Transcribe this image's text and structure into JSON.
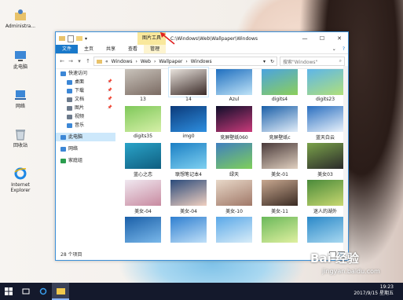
{
  "desktop": {
    "icons": [
      {
        "label": "Administra...",
        "icon": "user-folder-icon"
      },
      {
        "label": "此电脑",
        "icon": "computer-icon"
      },
      {
        "label": "网络",
        "icon": "network-icon"
      },
      {
        "label": "回收站",
        "icon": "recycle-bin-icon"
      },
      {
        "label": "Internet Explorer",
        "icon": "ie-icon"
      }
    ]
  },
  "window": {
    "picture_tools_label": "图片工具",
    "title": "C:\\Windows\\Web\\Wallpaper\\Windows",
    "ribbon_tabs": [
      "文件",
      "主页",
      "共享",
      "查看",
      "管理"
    ],
    "breadcrumb": [
      "Windows",
      "Web",
      "Wallpaper",
      "Windows"
    ],
    "search_placeholder": "搜索\"Windows\"",
    "status": "28 个项目"
  },
  "nav": [
    {
      "label": "快速访问",
      "icon": "star-icon",
      "color": "#3c87d6",
      "level": 0,
      "pinned": false
    },
    {
      "label": "桌面",
      "icon": "desktop-icon",
      "color": "#3c87d6",
      "level": 1,
      "pinned": true
    },
    {
      "label": "下载",
      "icon": "download-icon",
      "color": "#3c87d6",
      "level": 1,
      "pinned": true
    },
    {
      "label": "文档",
      "icon": "document-icon",
      "color": "#6c7a8c",
      "level": 1,
      "pinned": true
    },
    {
      "label": "图片",
      "icon": "pictures-icon",
      "color": "#6c7a8c",
      "level": 1,
      "pinned": true
    },
    {
      "label": "视频",
      "icon": "video-icon",
      "color": "#6c7a8c",
      "level": 1,
      "pinned": false
    },
    {
      "label": "音乐",
      "icon": "music-icon",
      "color": "#3c87d6",
      "level": 1,
      "pinned": false
    },
    {
      "label": "此电脑",
      "icon": "computer-icon",
      "color": "#3c87d6",
      "level": 0,
      "pinned": false,
      "selected": true
    },
    {
      "label": "网络",
      "icon": "network-icon",
      "color": "#3c87d6",
      "level": 0,
      "pinned": false
    },
    {
      "label": "家庭组",
      "icon": "homegroup-icon",
      "color": "#2b9d4f",
      "level": 0,
      "pinned": false
    }
  ],
  "files": [
    {
      "name": "13",
      "colors": [
        "#c9c3bb",
        "#7a6a62"
      ]
    },
    {
      "name": "14",
      "colors": [
        "#e8e2dc",
        "#3b2b28"
      ],
      "selected": true
    },
    {
      "name": "Azul",
      "colors": [
        "#1f6fbf",
        "#bfe3f7"
      ]
    },
    {
      "name": "digits4",
      "colors": [
        "#4aa3e0",
        "#8ccf5a"
      ]
    },
    {
      "name": "digits23",
      "colors": [
        "#5db5ea",
        "#b0e07a"
      ]
    },
    {
      "name": "digits35",
      "colors": [
        "#7fc85a",
        "#d6f0a8"
      ]
    },
    {
      "name": "img0",
      "colors": [
        "#0b3a7a",
        "#2e8fe0"
      ]
    },
    {
      "name": "竞屏壁纸060",
      "colors": [
        "#0e0e2a",
        "#c93a7a"
      ]
    },
    {
      "name": "竞屏壁纸c",
      "colors": [
        "#1a5fa8",
        "#e3eef9"
      ]
    },
    {
      "name": "蓝天白云",
      "colors": [
        "#2a6fc0",
        "#e9f2fb"
      ]
    },
    {
      "name": "蓝心之恋",
      "colors": [
        "#2aa3c8",
        "#0f5e80"
      ]
    },
    {
      "name": "联想笔记本4",
      "colors": [
        "#1b7fc4",
        "#7fd0f0"
      ]
    },
    {
      "name": "绿天",
      "colors": [
        "#3f7fbf",
        "#7fcf5a"
      ]
    },
    {
      "name": "美女-01",
      "colors": [
        "#4a3a3a",
        "#e0d0c0"
      ]
    },
    {
      "name": "美女03",
      "colors": [
        "#7aa24a",
        "#2a2a2a"
      ]
    },
    {
      "name": "美女-04",
      "colors": [
        "#f0e8f0",
        "#c88aa0"
      ]
    },
    {
      "name": "美女-04",
      "colors": [
        "#2a4a7a",
        "#f0d0c0"
      ]
    },
    {
      "name": "美女-10",
      "colors": [
        "#e8d8c8",
        "#a07868"
      ]
    },
    {
      "name": "美女-11",
      "colors": [
        "#c8a890",
        "#3a2a22"
      ]
    },
    {
      "name": "迷人的湖外",
      "colors": [
        "#4a8a3a",
        "#c8d870"
      ]
    },
    {
      "name": "",
      "colors": [
        "#1a5fa8",
        "#7ab8ea"
      ]
    },
    {
      "name": "",
      "colors": [
        "#2f7fd0",
        "#c0e0f8"
      ]
    },
    {
      "name": "",
      "colors": [
        "#5aa8e8",
        "#d8ecf8"
      ]
    },
    {
      "name": "",
      "colors": [
        "#6ab85a",
        "#e0f0a0"
      ]
    },
    {
      "name": "",
      "colors": [
        "#2a88c8",
        "#a8d8f0"
      ]
    }
  ],
  "taskbar": {
    "clock_time": "19:23",
    "clock_date": "2017/9/15 星期五"
  },
  "watermark": {
    "main": "Bai 经验",
    "sub": "jingyan.baidu.com"
  }
}
